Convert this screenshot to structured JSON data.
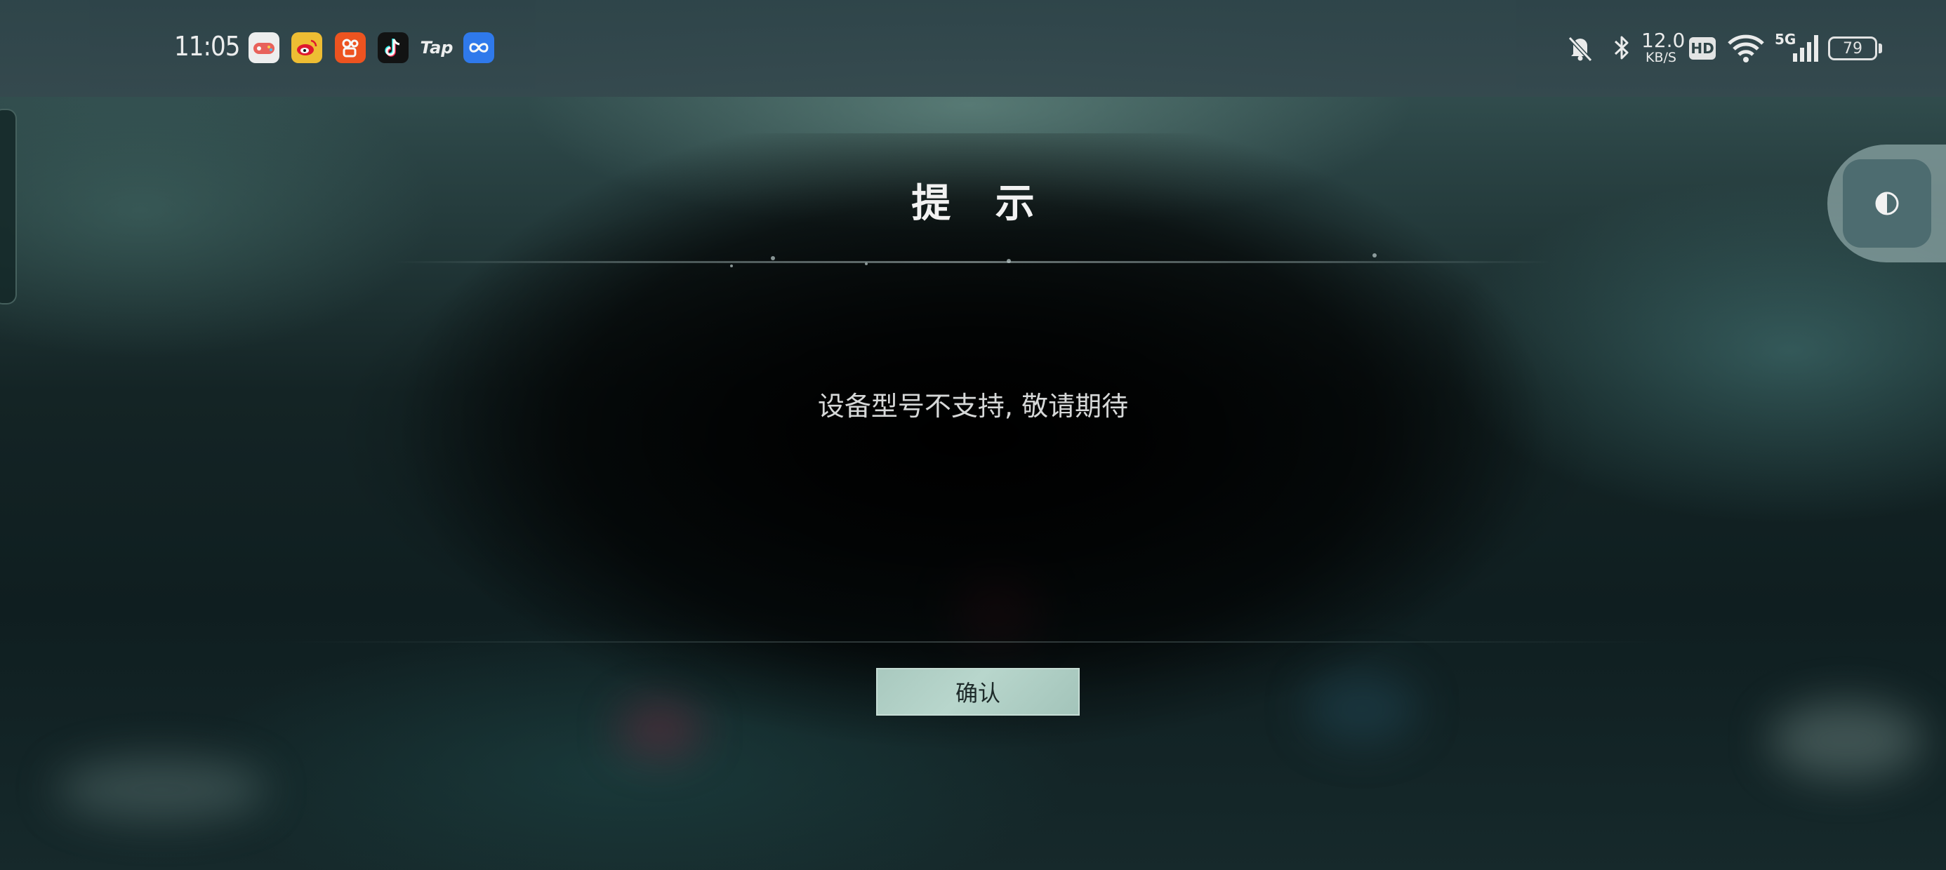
{
  "status_bar": {
    "time": "11:05",
    "apps": [
      {
        "icon": "game-center-icon",
        "color": "#f5f5f5"
      },
      {
        "icon": "weibo-icon",
        "color": "#f6c232"
      },
      {
        "icon": "kuaishou-icon",
        "color": "#f5541e"
      },
      {
        "icon": "tiktok-icon",
        "color": "#111111"
      },
      {
        "icon": "taptap-icon",
        "label": "Tap"
      },
      {
        "icon": "infinity-app-icon",
        "color": "#2f7bf2"
      }
    ],
    "network_speed_value": "12.0",
    "network_speed_unit": "KB/S",
    "hd_badge": "HD",
    "signal_label": "5G",
    "battery_level": "79"
  },
  "dialog": {
    "title": "提 示",
    "message": "设备型号不支持, 敬请期待",
    "confirm_label": "确认"
  },
  "colors": {
    "confirm_button": "#b2d1c6",
    "status_bar": "#33494e"
  }
}
